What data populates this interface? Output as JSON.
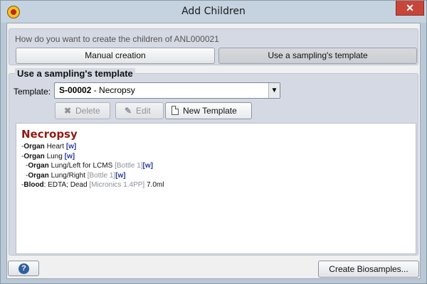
{
  "window": {
    "title": "Add Children",
    "close_glyph": "✕"
  },
  "question": {
    "text": "How do you want to create the children of ANL000021",
    "options": [
      "Manual creation",
      "Use a sampling's template"
    ],
    "selected": "Use a sampling's template"
  },
  "template_section": {
    "group_title": "Use a sampling's template",
    "template_label": "Template:",
    "selected_id": "S-00002",
    "selected_name": " - Necropsy",
    "dropdown_arrow": "▼",
    "buttons": {
      "delete": {
        "label": "Delete",
        "icon": "x-icon",
        "glyph": "✖",
        "enabled": false
      },
      "edit": {
        "label": "Edit",
        "icon": "pencil-icon",
        "glyph": "✎",
        "enabled": false
      },
      "new": {
        "label": "New Template",
        "icon": "document-icon",
        "enabled": true
      }
    }
  },
  "preview": {
    "title": "Necropsy",
    "lines": [
      {
        "prefix": "-",
        "kind": "Organ",
        "text": " Heart ",
        "container": "",
        "link": "[w]",
        "indent": false
      },
      {
        "prefix": "-",
        "kind": "Organ",
        "text": " Lung ",
        "container": "",
        "link": "[w]",
        "indent": false
      },
      {
        "prefix": "-",
        "kind": "Organ",
        "text": " Lung/Left for LCMS ",
        "container": "[Bottle 1]",
        "link": "[w]",
        "indent": true
      },
      {
        "prefix": "-",
        "kind": "Organ",
        "text": " Lung/Right ",
        "container": "[Bottle 1]",
        "link": "[w]",
        "indent": true
      },
      {
        "prefix": "-",
        "kind": "Blood",
        "text": ": EDTA; Dead ",
        "container": "[Micronics 1.4PP]",
        "link": "",
        "suffix": " 7.0ml",
        "indent": false
      }
    ]
  },
  "footer": {
    "help_glyph": "?",
    "create_label": "Create Biosamples..."
  },
  "colors": {
    "preview_title": "#8c1a12",
    "link": "#2438a8",
    "container_grey": "#8a8f95"
  }
}
